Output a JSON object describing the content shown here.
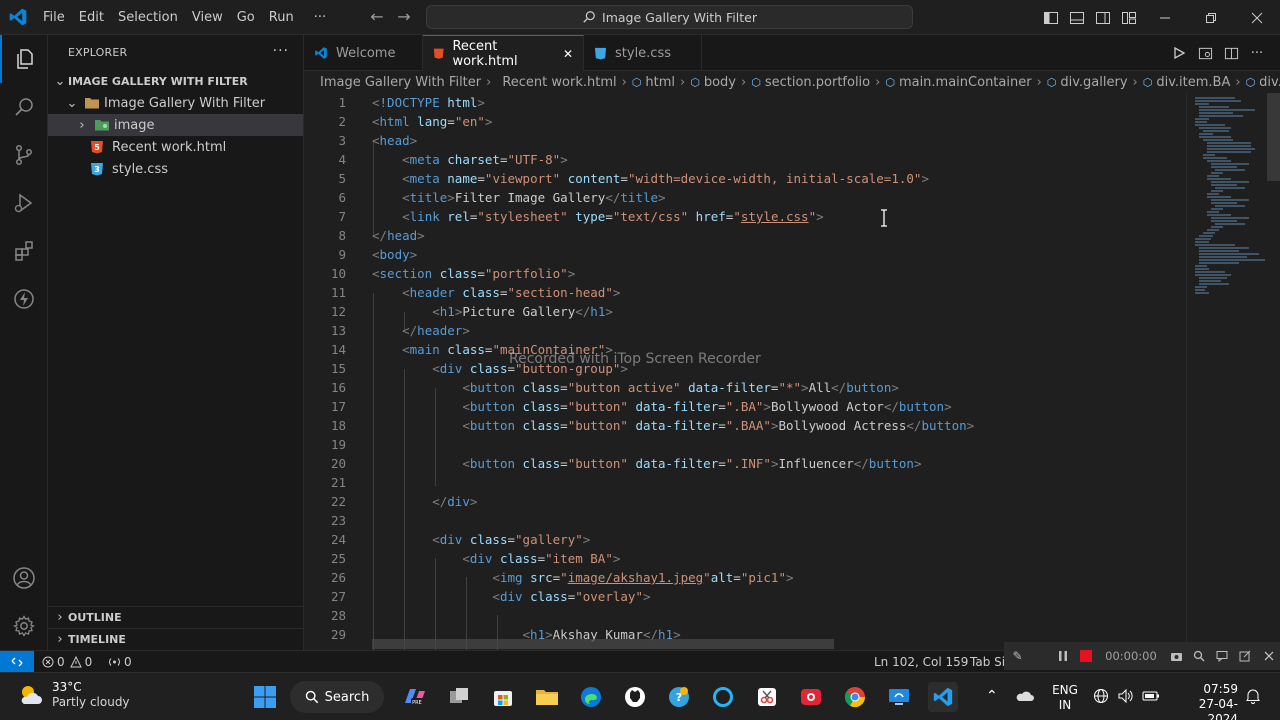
{
  "titlebar": {
    "menu": [
      "File",
      "Edit",
      "Selection",
      "View",
      "Go",
      "Run",
      "···"
    ],
    "command_center": "Image Gallery With Filter"
  },
  "sidebar": {
    "title": "EXPLORER",
    "more": "···",
    "workspace": "IMAGE GALLERY WITH FILTER",
    "root_folder": "Image Gallery With Filter",
    "items": [
      {
        "label": "image",
        "type": "folder"
      },
      {
        "label": "Recent work.html",
        "type": "html"
      },
      {
        "label": "style.css",
        "type": "css"
      }
    ],
    "outline": "OUTLINE",
    "timeline": "TIMELINE"
  },
  "tabs": [
    {
      "label": "Welcome",
      "icon": "vscode-icon",
      "active": false
    },
    {
      "label": "Recent work.html",
      "icon": "html-icon",
      "active": true,
      "close": "✕"
    },
    {
      "label": "style.css",
      "icon": "css-icon",
      "active": false
    }
  ],
  "breadcrumb": [
    "Image Gallery With Filter",
    "Recent work.html",
    "html",
    "body",
    "section.portfolio",
    "main.mainContainer",
    "div.gallery",
    "div.item.BA",
    "div.overla"
  ],
  "editor": {
    "line_numbers": [
      "1",
      "2",
      "3",
      "4",
      "5",
      "6",
      "7",
      "8",
      "9",
      "10",
      "11",
      "12",
      "13",
      "14",
      "15",
      "16",
      "17",
      "18",
      "19",
      "20",
      "21",
      "22",
      "23",
      "24",
      "25",
      "26",
      "27",
      "28",
      "29"
    ],
    "watermark": "Recorded with iTop Screen Recorder"
  },
  "recorder": {
    "time": "00:00:00"
  },
  "statusbar": {
    "errors": "0",
    "warnings": "0",
    "ports": "0",
    "cursor_pos": "Ln 102, Col 159",
    "tab_size": "Tab Siz"
  },
  "taskbar": {
    "weather_temp": "33°C",
    "weather_cond": "Partly cloudy",
    "search": "Search",
    "lang_top": "ENG",
    "lang_bottom": "IN",
    "time": "07:59",
    "date": "27-04-2024"
  },
  "colors": {
    "accent": "#0078d4",
    "tag": "#569cd6",
    "attr": "#9cdcfe",
    "string": "#ce9178"
  }
}
